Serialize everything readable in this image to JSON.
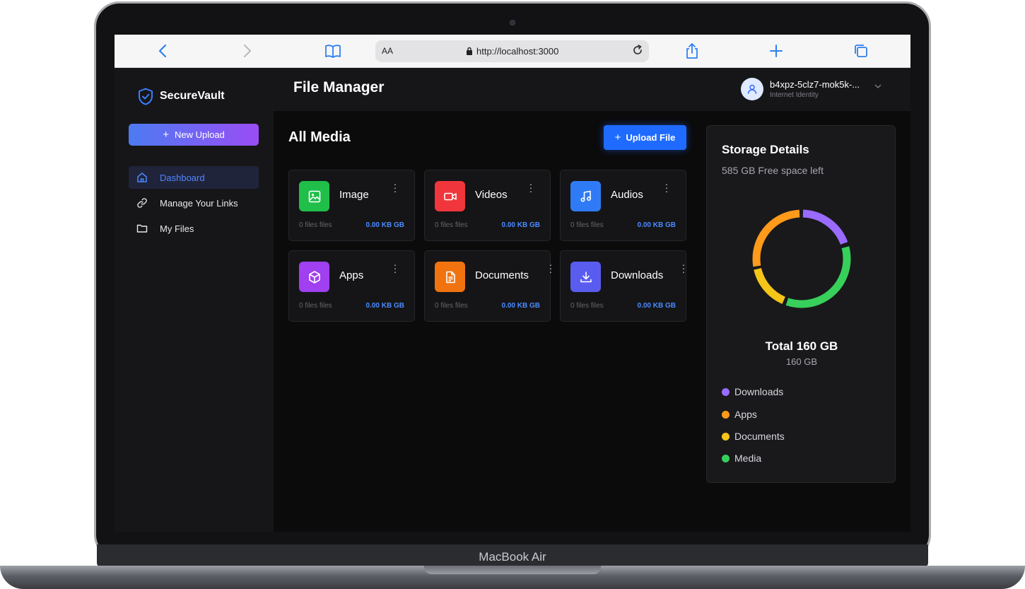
{
  "device": {
    "label": "MacBook Air"
  },
  "browser": {
    "aa_label": "AA",
    "url": "http://localhost:3000"
  },
  "brand": {
    "name": "SecureVault"
  },
  "sidebar": {
    "new_upload_label": "New Upload",
    "items": [
      {
        "label": "Dashboard",
        "icon": "home-icon",
        "active": true
      },
      {
        "label": "Manage Your Links",
        "icon": "link-icon",
        "active": false
      },
      {
        "label": "My Files",
        "icon": "folder-icon",
        "active": false
      }
    ]
  },
  "header": {
    "title": "File Manager",
    "user": {
      "name": "b4xpz-5clz7-mok5k-...",
      "subtitle": "Internet Identity"
    }
  },
  "main": {
    "title": "All Media",
    "upload_label": "Upload File",
    "cards": [
      {
        "title": "Image",
        "count": "0 files files",
        "size": "0.00 KB GB",
        "icon": "image-icon",
        "color": "#1fbf4a"
      },
      {
        "title": "Videos",
        "count": "0 files files",
        "size": "0.00 KB GB",
        "icon": "video-icon",
        "color": "#f0363c"
      },
      {
        "title": "Audios",
        "count": "0 files files",
        "size": "0.00 KB GB",
        "icon": "music-icon",
        "color": "#2f7bf5"
      },
      {
        "title": "Apps",
        "count": "0 files files",
        "size": "0.00 KB GB",
        "icon": "cube-icon",
        "color": "#a040f0"
      },
      {
        "title": "Documents",
        "count": "0 files files",
        "size": "0.00 KB GB",
        "icon": "document-icon",
        "color": "#f0730f"
      },
      {
        "title": "Downloads",
        "count": "0 files files",
        "size": "0.00 KB GB",
        "icon": "download-icon",
        "color": "#5a5cf0"
      }
    ]
  },
  "storage": {
    "title": "Storage Details",
    "free": "585 GB Free space left",
    "total_title": "Total 160 GB",
    "total_sub": "160 GB",
    "legend": [
      {
        "label": "Downloads",
        "color": "#9a6bff"
      },
      {
        "label": "Apps",
        "color": "#ff9a1a"
      },
      {
        "label": "Documents",
        "color": "#f5c518"
      },
      {
        "label": "Media",
        "color": "#37d05a"
      }
    ]
  }
}
